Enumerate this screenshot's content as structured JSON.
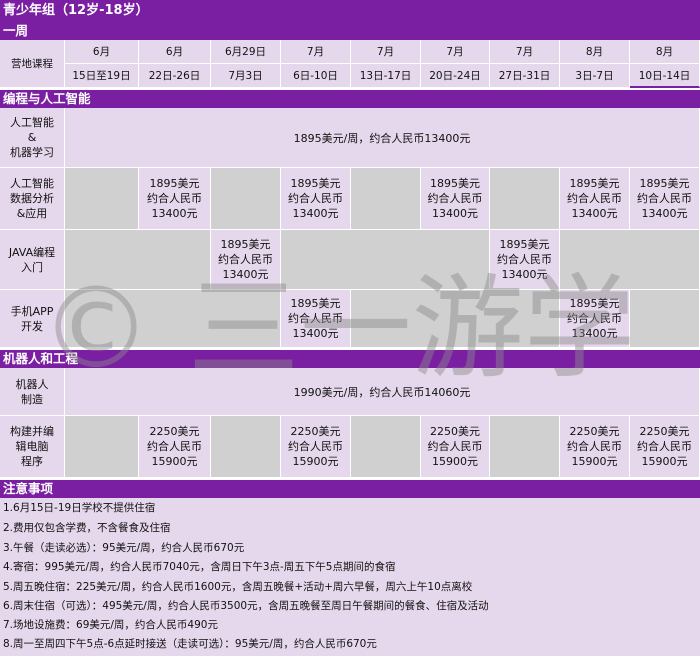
{
  "title": "青少年组（12岁-18岁）",
  "week_label": "一周",
  "header": {
    "camp_label": "营地课程",
    "months": [
      "6月",
      "6月",
      "6月29日",
      "7月",
      "7月",
      "7月",
      "7月",
      "8月",
      "8月"
    ],
    "dates": [
      "15日至19日",
      "22日-26日",
      "7月3日",
      "6日-10日",
      "13日-17日",
      "20日-24日",
      "27日-31日",
      "3日-7日",
      "10日-14日"
    ]
  },
  "sections": {
    "coding": "编程与人工智能",
    "robotics": "机器人和工程"
  },
  "courses": {
    "ai_ml": {
      "label": "人工智能\n&\n机器学习",
      "price": "1895美元/周，约合人民币13400元"
    },
    "ai_data": {
      "label": "人工智能\n数据分析\n&应用",
      "price": "1895美元\n约合人民币\n13400元"
    },
    "java": {
      "label": "JAVA编程\n入门",
      "price": "1895美元\n约合人民币\n13400元"
    },
    "app": {
      "label": "手机APP\n开发",
      "price": "1895美元\n约合人民币\n13400元"
    },
    "robot": {
      "label": "机器人\n制造",
      "price": "1990美元/周，约合人民币14060元"
    },
    "computer": {
      "label": "构建并编\n辑电脑\n程序",
      "price": "2250美元\n约合人民币\n15900元"
    }
  },
  "notes": {
    "title": "注意事项",
    "items": [
      "1.6月15日-19日学校不提供住宿",
      "2.费用仅包含学费，不含餐食及住宿",
      "3.午餐（走读必选）：95美元/周，约合人民币670元",
      "4.寄宿：995美元/周，约合人民币7040元，含周日下午3点-周五下午5点期间的食宿",
      "5.周五晚住宿：225美元/周，约合人民币1600元，含周五晚餐+活动+周六早餐，周六上午10点离校",
      "6.周末住宿（可选）：495美元/周，约合人民币3500元，含周五晚餐至周日午餐期间的餐食、住宿及活动",
      "7.场地设施费：69美元/周，约合人民币490元",
      "8.周一至周四下午5点-6点延时接送（走读可选）：95美元/周，约合人民币670元"
    ]
  },
  "watermark": "© 三一游学",
  "colors": {
    "band": "#7a1fa2",
    "lavender": "#e6d8ec",
    "gray": "#d0d0d0",
    "watermark": "#8a8a8a"
  }
}
